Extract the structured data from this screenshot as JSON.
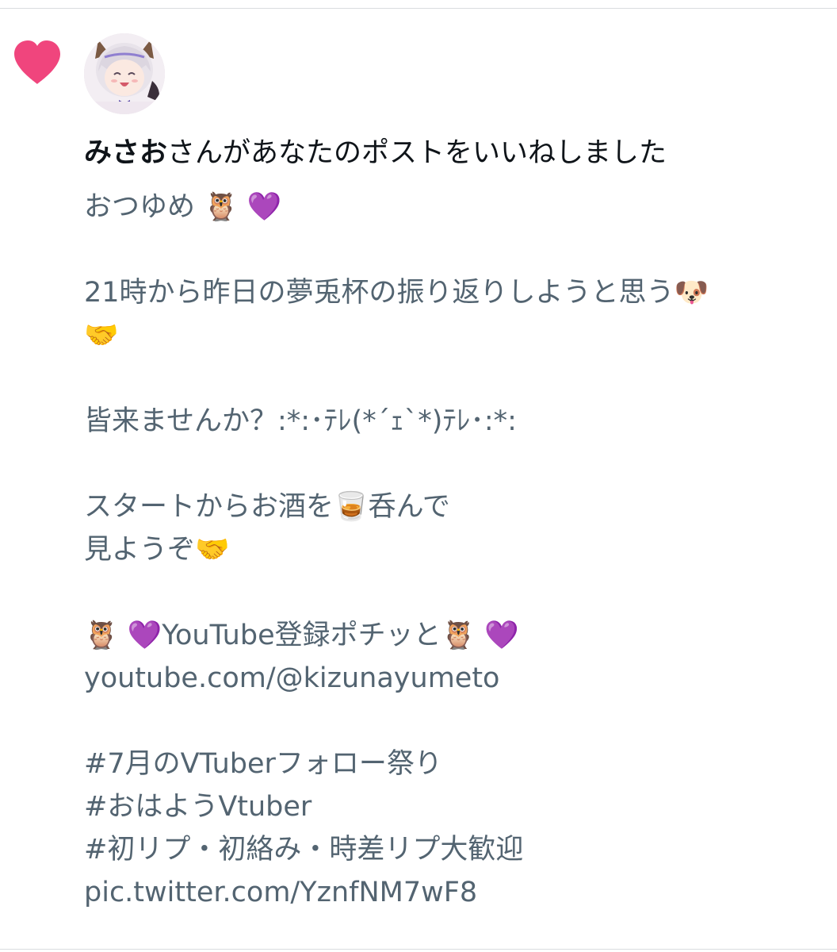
{
  "notification": {
    "user_name": "みさお",
    "action_text": "さんがあなたのポストをいいねしました"
  },
  "post": {
    "lines": [
      "おつゆめ 🦉 💜",
      "",
      "21時から昨日の夢兎杯の振り返りしようと思う🐶",
      "🤝",
      "",
      "皆来ませんか？:*:･ﾃﾚ(*´ｪ`*)ﾃﾚ･:*:",
      "",
      "スタートからお酒を🥃呑んで",
      "見ようぞ🤝",
      "",
      "🦉 💜YouTube登録ポチッと🦉 💜",
      "youtube.com/@kizunayumeto",
      "",
      "#7月のVTuberフォロー祭り",
      "#おはようVtuber",
      "#初リプ・初絡み・時差リプ大歓迎",
      "pic.twitter.com/YznfNM7wF8"
    ]
  },
  "colors": {
    "heart": "#f0457d",
    "body_text": "#536471",
    "primary_text": "#0f1419"
  },
  "icons": {
    "like": "heart-icon",
    "avatar": "anime-avatar"
  }
}
